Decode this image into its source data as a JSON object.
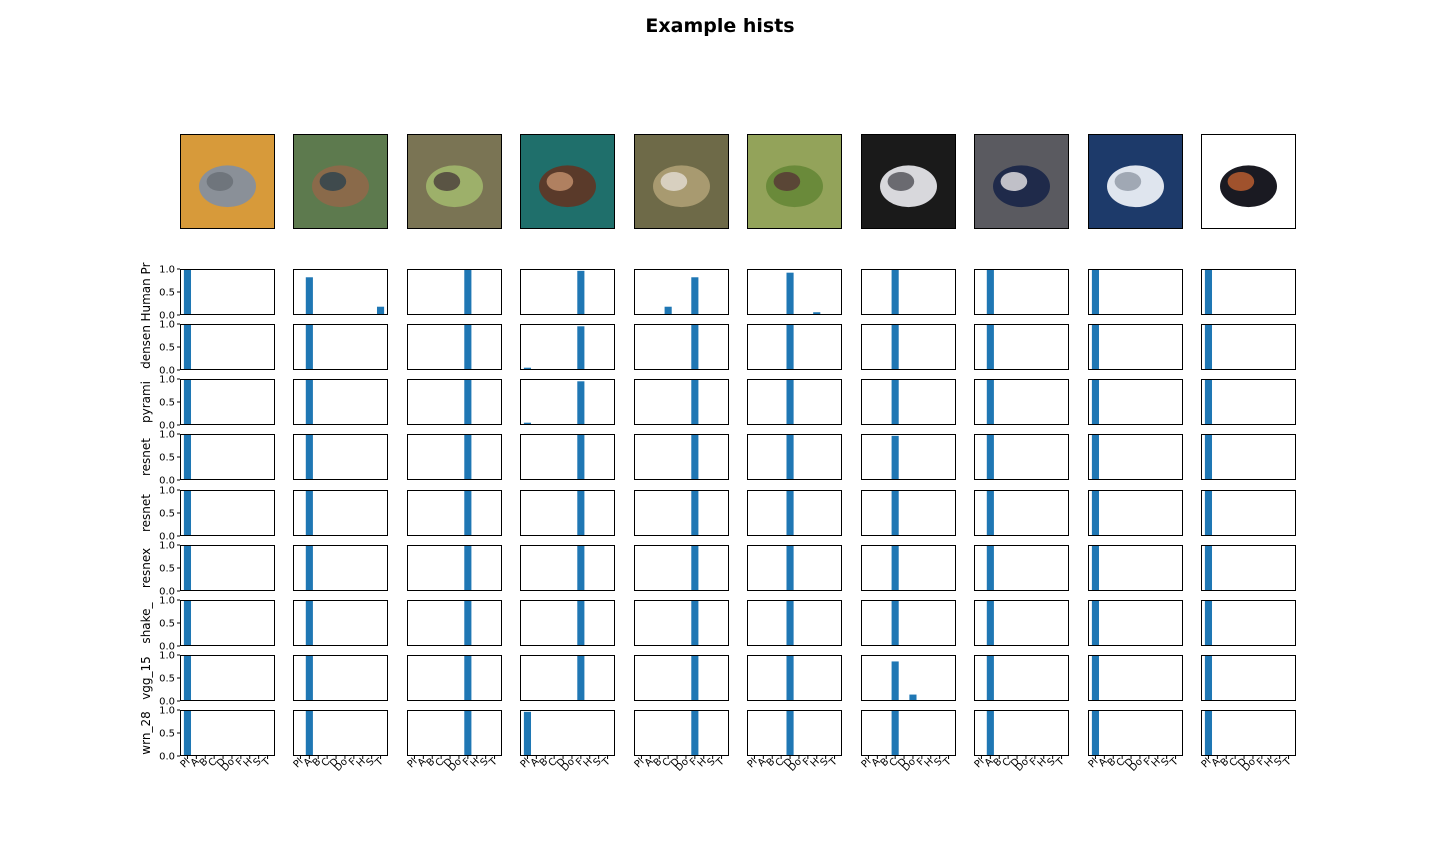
{
  "figure": {
    "title": "Example hists"
  },
  "images": [
    {
      "icon": "airplane-photo-icon",
      "colors": [
        "#d79a3a",
        "#8a9098",
        "#6f757c"
      ]
    },
    {
      "icon": "car-photo-icon",
      "colors": [
        "#5d7a4e",
        "#8a6a4a",
        "#3f4a4d"
      ]
    },
    {
      "icon": "frog-photo-icon",
      "colors": [
        "#7a7454",
        "#9db06a",
        "#5a5444"
      ]
    },
    {
      "icon": "frog-photo-icon",
      "colors": [
        "#1f6f6b",
        "#5a3a2a",
        "#b08060"
      ]
    },
    {
      "icon": "frog-photo-icon",
      "colors": [
        "#6e6a48",
        "#a89a70",
        "#d8d0c0"
      ]
    },
    {
      "icon": "deer-photo-icon",
      "colors": [
        "#93a35a",
        "#6a8a3a",
        "#5a4636"
      ]
    },
    {
      "icon": "cat-photo-icon",
      "colors": [
        "#1a1a1a",
        "#d8d8dc",
        "#6a6a70"
      ]
    },
    {
      "icon": "car-photo-icon",
      "colors": [
        "#5a5a60",
        "#1f2a4a",
        "#c0c0c8"
      ]
    },
    {
      "icon": "airplane-photo-icon",
      "colors": [
        "#1d3a6a",
        "#dfe5ee",
        "#a0a8b4"
      ]
    },
    {
      "icon": "airplane-photo-icon",
      "colors": [
        "#ffffff",
        "#1a1a22",
        "#a0522d"
      ]
    }
  ],
  "chart_data": {
    "type": "bar",
    "title": "Example hists",
    "ylim": [
      0,
      1
    ],
    "yticks": [
      "0.0",
      "0.5",
      "1.0"
    ],
    "categories": [
      "Pl",
      "A",
      "B",
      "C",
      "D",
      "Do",
      "F",
      "H",
      "S",
      "T"
    ],
    "bar_color": "#1f77b4",
    "rows": [
      {
        "label": "Human Pr",
        "cols": [
          [
            1,
            0,
            0,
            0,
            0,
            0,
            0,
            0,
            0,
            0
          ],
          [
            0,
            0.82,
            0,
            0,
            0,
            0,
            0,
            0,
            0,
            0.18
          ],
          [
            0,
            0,
            0,
            0,
            0,
            0,
            1,
            0,
            0,
            0
          ],
          [
            0,
            0,
            0.02,
            0,
            0,
            0,
            0.96,
            0,
            0.02,
            0
          ],
          [
            0,
            0,
            0,
            0.18,
            0,
            0,
            0.82,
            0,
            0,
            0
          ],
          [
            0,
            0,
            0,
            0,
            0.92,
            0.02,
            0,
            0.06,
            0,
            0
          ],
          [
            0,
            0,
            0,
            1,
            0,
            0.02,
            0,
            0,
            0,
            0
          ],
          [
            0,
            1,
            0.02,
            0,
            0,
            0,
            0,
            0,
            0,
            0
          ],
          [
            1,
            0,
            0,
            0,
            0,
            0,
            0,
            0,
            0.02,
            0
          ],
          [
            1,
            0,
            0,
            0,
            0,
            0,
            0,
            0,
            0,
            0
          ]
        ]
      },
      {
        "label": "densen",
        "cols": [
          [
            1,
            0,
            0,
            0,
            0,
            0,
            0,
            0,
            0,
            0
          ],
          [
            0,
            1,
            0,
            0,
            0,
            0,
            0,
            0,
            0,
            0
          ],
          [
            0,
            0,
            0,
            0,
            0,
            0,
            1,
            0,
            0,
            0
          ],
          [
            0.05,
            0,
            0,
            0,
            0,
            0,
            0.95,
            0,
            0,
            0
          ],
          [
            0,
            0,
            0,
            0,
            0,
            0,
            1,
            0,
            0,
            0
          ],
          [
            0,
            0,
            0,
            0,
            1,
            0,
            0,
            0,
            0,
            0
          ],
          [
            0,
            0,
            0,
            1,
            0,
            0,
            0,
            0,
            0,
            0
          ],
          [
            0,
            1,
            0,
            0,
            0,
            0,
            0,
            0,
            0,
            0
          ],
          [
            1,
            0,
            0,
            0,
            0,
            0,
            0,
            0,
            0,
            0
          ],
          [
            1,
            0,
            0,
            0,
            0,
            0,
            0,
            0,
            0,
            0
          ]
        ]
      },
      {
        "label": "pyrami",
        "cols": [
          [
            1,
            0,
            0,
            0,
            0,
            0,
            0,
            0,
            0,
            0
          ],
          [
            0,
            1,
            0,
            0,
            0,
            0,
            0,
            0,
            0,
            0
          ],
          [
            0,
            0,
            0,
            0,
            0,
            0,
            1,
            0,
            0,
            0
          ],
          [
            0.05,
            0,
            0,
            0,
            0,
            0,
            0.95,
            0,
            0,
            0
          ],
          [
            0,
            0,
            0,
            0,
            0,
            0,
            1,
            0,
            0,
            0
          ],
          [
            0,
            0,
            0,
            0,
            1,
            0,
            0,
            0,
            0,
            0
          ],
          [
            0,
            0,
            0,
            1,
            0,
            0,
            0,
            0,
            0,
            0
          ],
          [
            0,
            1,
            0,
            0,
            0,
            0,
            0,
            0,
            0,
            0
          ],
          [
            1,
            0,
            0,
            0,
            0,
            0,
            0,
            0,
            0,
            0
          ],
          [
            1,
            0,
            0,
            0,
            0,
            0,
            0,
            0,
            0,
            0
          ]
        ]
      },
      {
        "label": "resnet",
        "cols": [
          [
            1,
            0,
            0,
            0,
            0,
            0,
            0,
            0,
            0,
            0
          ],
          [
            0,
            1,
            0,
            0,
            0,
            0,
            0,
            0,
            0,
            0
          ],
          [
            0,
            0,
            0,
            0,
            0,
            0,
            1,
            0,
            0,
            0
          ],
          [
            0,
            0,
            0,
            0,
            0,
            0,
            1,
            0,
            0,
            0
          ],
          [
            0,
            0,
            0,
            0,
            0,
            0,
            1,
            0,
            0,
            0
          ],
          [
            0,
            0,
            0,
            0,
            1,
            0,
            0,
            0,
            0,
            0
          ],
          [
            0,
            0,
            0,
            0.96,
            0,
            0.02,
            0,
            0,
            0,
            0
          ],
          [
            0,
            1,
            0,
            0,
            0,
            0,
            0,
            0,
            0,
            0
          ],
          [
            1,
            0,
            0,
            0,
            0,
            0,
            0,
            0,
            0,
            0
          ],
          [
            1,
            0,
            0,
            0,
            0,
            0,
            0,
            0,
            0,
            0
          ]
        ]
      },
      {
        "label": "resnet",
        "cols": [
          [
            1,
            0,
            0,
            0,
            0,
            0,
            0,
            0,
            0,
            0
          ],
          [
            0,
            1,
            0,
            0,
            0,
            0,
            0,
            0,
            0,
            0
          ],
          [
            0,
            0,
            0,
            0,
            0,
            0,
            1,
            0,
            0,
            0
          ],
          [
            0,
            0,
            0,
            0,
            0,
            0,
            1,
            0,
            0,
            0
          ],
          [
            0,
            0,
            0,
            0,
            0,
            0,
            1,
            0,
            0,
            0
          ],
          [
            0,
            0,
            0,
            0,
            1,
            0,
            0,
            0,
            0,
            0
          ],
          [
            0,
            0,
            0,
            1,
            0,
            0,
            0,
            0,
            0,
            0
          ],
          [
            0,
            1,
            0,
            0,
            0,
            0,
            0,
            0,
            0,
            0
          ],
          [
            1,
            0,
            0,
            0,
            0,
            0,
            0,
            0,
            0,
            0
          ],
          [
            1,
            0,
            0,
            0,
            0,
            0,
            0,
            0,
            0,
            0
          ]
        ]
      },
      {
        "label": "resnex",
        "cols": [
          [
            1,
            0,
            0,
            0,
            0,
            0,
            0,
            0,
            0,
            0
          ],
          [
            0,
            1,
            0,
            0,
            0,
            0,
            0,
            0,
            0,
            0
          ],
          [
            0,
            0,
            0,
            0,
            0,
            0,
            1,
            0,
            0,
            0
          ],
          [
            0,
            0,
            0,
            0,
            0,
            0,
            1,
            0,
            0,
            0
          ],
          [
            0,
            0,
            0,
            0,
            0,
            0,
            1,
            0,
            0,
            0
          ],
          [
            0,
            0,
            0,
            0,
            1,
            0,
            0,
            0,
            0,
            0
          ],
          [
            0,
            0,
            0,
            1,
            0,
            0,
            0,
            0,
            0,
            0
          ],
          [
            0,
            1,
            0,
            0,
            0,
            0,
            0,
            0,
            0,
            0
          ],
          [
            1,
            0,
            0,
            0,
            0,
            0,
            0,
            0,
            0,
            0
          ],
          [
            1,
            0,
            0,
            0,
            0,
            0,
            0,
            0,
            0,
            0
          ]
        ]
      },
      {
        "label": "shake_",
        "cols": [
          [
            1,
            0,
            0,
            0,
            0,
            0,
            0,
            0,
            0,
            0
          ],
          [
            0,
            1,
            0,
            0,
            0,
            0,
            0,
            0,
            0,
            0
          ],
          [
            0,
            0,
            0,
            0,
            0,
            0,
            1,
            0,
            0,
            0
          ],
          [
            0,
            0,
            0,
            0,
            0,
            0,
            1,
            0,
            0,
            0
          ],
          [
            0,
            0,
            0,
            0,
            0,
            0,
            1,
            0,
            0,
            0
          ],
          [
            0,
            0,
            0,
            0,
            1,
            0,
            0,
            0,
            0,
            0
          ],
          [
            0,
            0,
            0,
            1,
            0,
            0,
            0,
            0,
            0,
            0
          ],
          [
            0,
            1,
            0,
            0,
            0,
            0,
            0,
            0,
            0,
            0
          ],
          [
            1,
            0,
            0,
            0,
            0,
            0,
            0,
            0,
            0,
            0
          ],
          [
            1,
            0,
            0,
            0,
            0,
            0,
            0,
            0,
            0,
            0
          ]
        ]
      },
      {
        "label": "vgg_15",
        "cols": [
          [
            1,
            0,
            0,
            0,
            0,
            0,
            0,
            0,
            0,
            0
          ],
          [
            0,
            1,
            0,
            0,
            0,
            0,
            0,
            0,
            0,
            0
          ],
          [
            0,
            0,
            0,
            0,
            0,
            0,
            1,
            0,
            0,
            0
          ],
          [
            0,
            0,
            0,
            0,
            0,
            0,
            1,
            0,
            0,
            0
          ],
          [
            0,
            0,
            0,
            0,
            0,
            0,
            1,
            0,
            0,
            0
          ],
          [
            0,
            0,
            0,
            0,
            1,
            0,
            0,
            0,
            0,
            0
          ],
          [
            0,
            0,
            0,
            0.86,
            0,
            0.14,
            0,
            0,
            0,
            0
          ],
          [
            0,
            1,
            0,
            0,
            0,
            0,
            0,
            0,
            0,
            0
          ],
          [
            1,
            0,
            0,
            0,
            0,
            0,
            0,
            0,
            0,
            0
          ],
          [
            1,
            0,
            0,
            0,
            0,
            0,
            0,
            0,
            0,
            0
          ]
        ]
      },
      {
        "label": "wrn_28",
        "cols": [
          [
            1,
            0,
            0,
            0,
            0,
            0,
            0,
            0,
            0,
            0
          ],
          [
            0,
            1,
            0,
            0,
            0,
            0,
            0,
            0,
            0,
            0
          ],
          [
            0,
            0,
            0,
            0,
            0,
            0,
            1,
            0,
            0,
            0
          ],
          [
            0.96,
            0,
            0,
            0,
            0,
            0,
            0.02,
            0,
            0,
            0
          ],
          [
            0,
            0,
            0,
            0,
            0,
            0,
            1,
            0,
            0,
            0
          ],
          [
            0,
            0,
            0,
            0,
            1,
            0,
            0,
            0,
            0,
            0
          ],
          [
            0,
            0,
            0,
            1,
            0,
            0,
            0,
            0,
            0,
            0
          ],
          [
            0,
            1,
            0,
            0,
            0,
            0,
            0,
            0,
            0,
            0
          ],
          [
            1,
            0,
            0,
            0,
            0,
            0,
            0,
            0,
            0,
            0
          ],
          [
            1,
            0,
            0,
            0,
            0,
            0,
            0,
            0,
            0,
            0
          ]
        ]
      }
    ]
  }
}
